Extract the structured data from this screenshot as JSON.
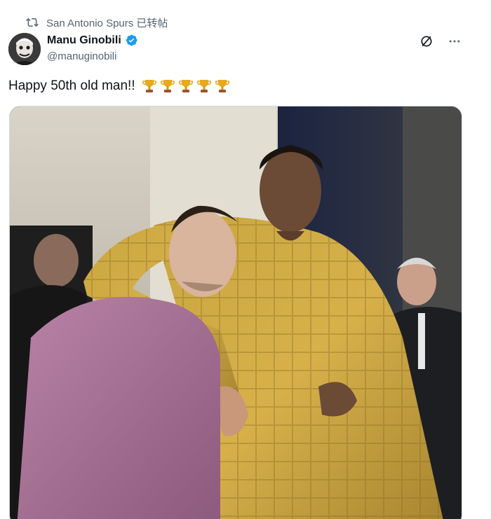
{
  "repost": {
    "icon": "repost-icon",
    "text": "San Antonio Spurs 已转帖"
  },
  "author": {
    "avatar_icon": "avatar",
    "name": "Manu Ginobili",
    "handle": "@manuginobili",
    "verified_icon": "verified-badge-icon"
  },
  "actions": {
    "grok_icon": "grok-icon",
    "more_icon": "more-icon"
  },
  "tweet": {
    "text": "Happy 50th old man!!",
    "emoji": [
      "trophy-icon",
      "trophy-icon",
      "trophy-icon",
      "trophy-icon",
      "trophy-icon"
    ]
  },
  "colors": {
    "accent": "#1d9bf0",
    "secondary_text": "#536471",
    "trophy_gold": "#e8a91c"
  },
  "media": {
    "type": "photo"
  }
}
